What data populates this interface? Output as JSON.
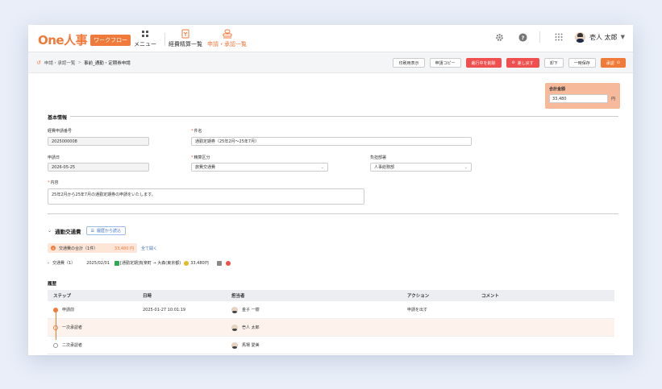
{
  "app": {
    "logo_text": "One人事",
    "logo_badge": "ワークフロー",
    "nav": [
      {
        "label": "メニュー",
        "icon": "grid-icon"
      },
      {
        "label": "経費精算一覧",
        "icon": "receipt-icon"
      },
      {
        "label": "申請・承認一覧",
        "icon": "stamp-icon",
        "active": true
      }
    ],
    "user_name": "壱人 太郎"
  },
  "breadcrumb": {
    "items": [
      "申請・承認一覧",
      "事前_通勤・定期券申請"
    ]
  },
  "actions": [
    {
      "label": "印刷用表示",
      "style": "default"
    },
    {
      "label": "申請コピー",
      "style": "default"
    },
    {
      "label": "裁行中を削除",
      "style": "red"
    },
    {
      "label": "差し戻す",
      "style": "red"
    },
    {
      "label": "却下",
      "style": "default"
    },
    {
      "label": "一時保存",
      "style": "default"
    },
    {
      "label": "承認",
      "style": "orange"
    }
  ],
  "total": {
    "label": "合計金額",
    "value": "33,480",
    "unit": "円"
  },
  "basic": {
    "title": "基本情報",
    "expense_no_label": "経費申請番号",
    "expense_no": "2025000008",
    "subject_label": "件名",
    "subject": "通勤定期券（25年2月〜25年7月）",
    "date_label": "申請日",
    "date": "2026-05-25",
    "category_label": "精算区分",
    "category": "旅費交通費",
    "dept_label": "負担部署",
    "dept": "人事総務部",
    "content_label": "内容",
    "content": "25年2月から25年7月の通勤定期券の申請をいたします。"
  },
  "commute": {
    "title": "通勤交通費",
    "history_button": "履歴から読込",
    "total_label": "交通費の合計（1件）",
    "total_amount": "33,480 円",
    "expand_all": "全て開く",
    "row_label": "交通費（1）",
    "row_date": "2025/02/01",
    "row_route": "[通勤定期]有楽町 → 大森(東京都)",
    "row_amount": "33,480円"
  },
  "history": {
    "title": "履歴",
    "columns": [
      "ステップ",
      "日時",
      "担当者",
      "アクション",
      "コメント"
    ],
    "rows": [
      {
        "step": "申請前",
        "datetime": "2025-01-27 10:01:19",
        "person": "金子 一樹",
        "action": "申請を出す",
        "comment": "",
        "state": "done"
      },
      {
        "step": "一次承認者",
        "datetime": "",
        "person": "壱人 太郎",
        "action": "",
        "comment": "",
        "state": "current"
      },
      {
        "step": "二次承認者",
        "datetime": "",
        "person": "馬場 愛美",
        "action": "",
        "comment": "",
        "state": "todo"
      }
    ]
  },
  "colors": {
    "brand": "#f07a3a",
    "danger": "#ef4f4f",
    "link": "#3d6fc0"
  }
}
